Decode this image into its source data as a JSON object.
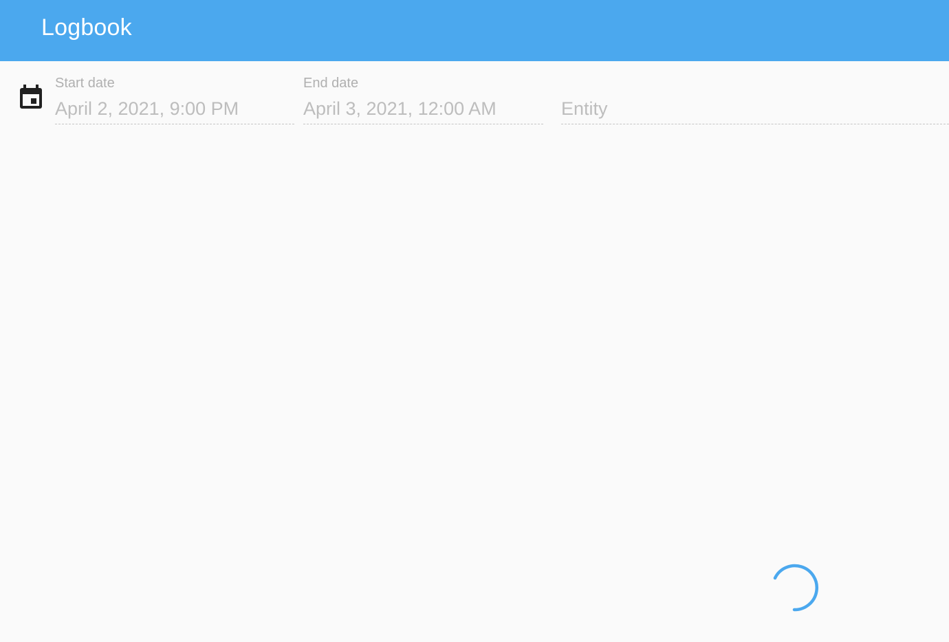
{
  "header": {
    "title": "Logbook",
    "background_color": "#4ba8ee"
  },
  "filters": {
    "calendar_icon": "calendar-icon",
    "start_date": {
      "label": "Start date",
      "value": "April 2, 2021, 9:00 PM"
    },
    "end_date": {
      "label": "End date",
      "value": "April 3, 2021, 12:00 AM"
    },
    "entity": {
      "placeholder": "Entity"
    }
  },
  "loading": {
    "icon": "loading-spinner-icon",
    "color": "#4ba8ee"
  }
}
